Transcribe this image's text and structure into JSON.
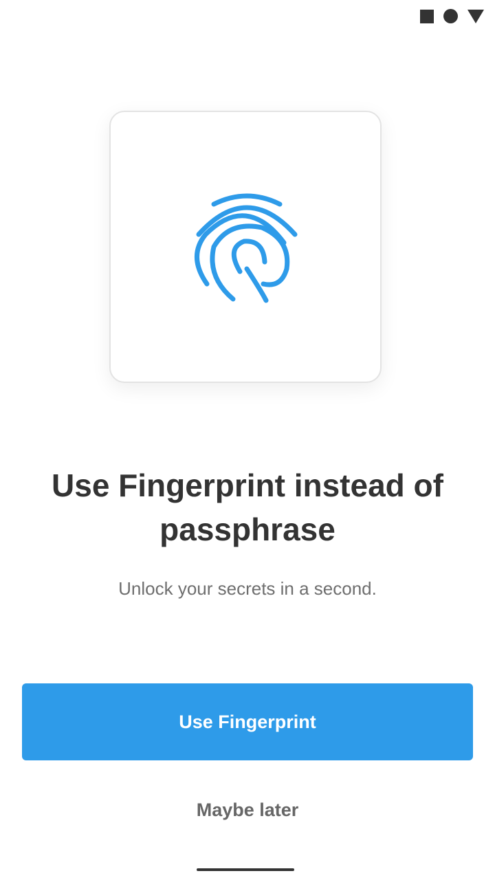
{
  "status_bar": {
    "icons": [
      "square-icon",
      "circle-icon",
      "triangle-down-icon"
    ]
  },
  "illustration": {
    "icon": "fingerprint-icon",
    "accent_color": "#2e9be9"
  },
  "onboarding": {
    "title": "Use Fingerprint instead of passphrase",
    "subtitle": "Unlock your secrets in a second."
  },
  "actions": {
    "primary_label": "Use Fingerprint",
    "secondary_label": "Maybe later"
  },
  "colors": {
    "primary": "#2e9be9",
    "title_text": "#333333",
    "body_text": "#6e6e6e"
  }
}
